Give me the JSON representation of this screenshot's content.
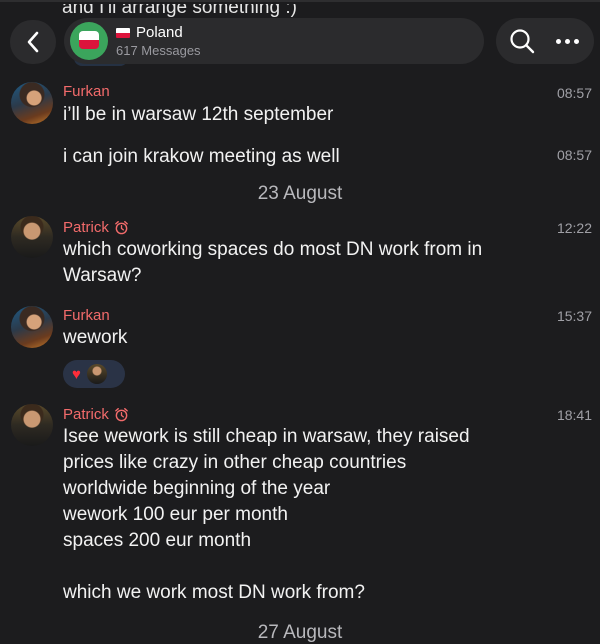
{
  "previous_message": {
    "text": "and I'll arrange something :)"
  },
  "header": {
    "group_title": "Poland",
    "message_count": "617 Messages"
  },
  "messages": [
    {
      "sender": "Furkan",
      "text": "i’ll be in warsaw 12th september",
      "time": "08:57"
    },
    {
      "text": "i can join krakow meeting as well",
      "time": "08:57"
    },
    {
      "date": "23 August"
    },
    {
      "sender": "Patrick",
      "sender_emoji": "alarm-clock-icon",
      "lines": [
        "which coworking spaces do most DN work from in",
        "Warsaw?"
      ],
      "time": "12:22"
    },
    {
      "sender": "Furkan",
      "text": "wework",
      "time": "15:37",
      "reactions": [
        {
          "icon": "heart-icon"
        },
        {
          "icon": "reactor-avatar"
        }
      ]
    },
    {
      "sender": "Patrick",
      "sender_emoji": "alarm-clock-icon",
      "lines": [
        "Isee wework is still cheap in warsaw, they raised",
        "prices like crazy in other cheap countries",
        "worldwide beginning of the year",
        "wework 100 eur per month",
        "spaces 200 eur month",
        "",
        "which we work most DN work from?"
      ],
      "time": "18:41"
    },
    {
      "date": "27 August"
    }
  ],
  "colors": {
    "background": "#1c1c1e",
    "sender_name": "#f26b6b",
    "pill": "#2c2c2e",
    "reaction_bg": "#2a3346"
  }
}
